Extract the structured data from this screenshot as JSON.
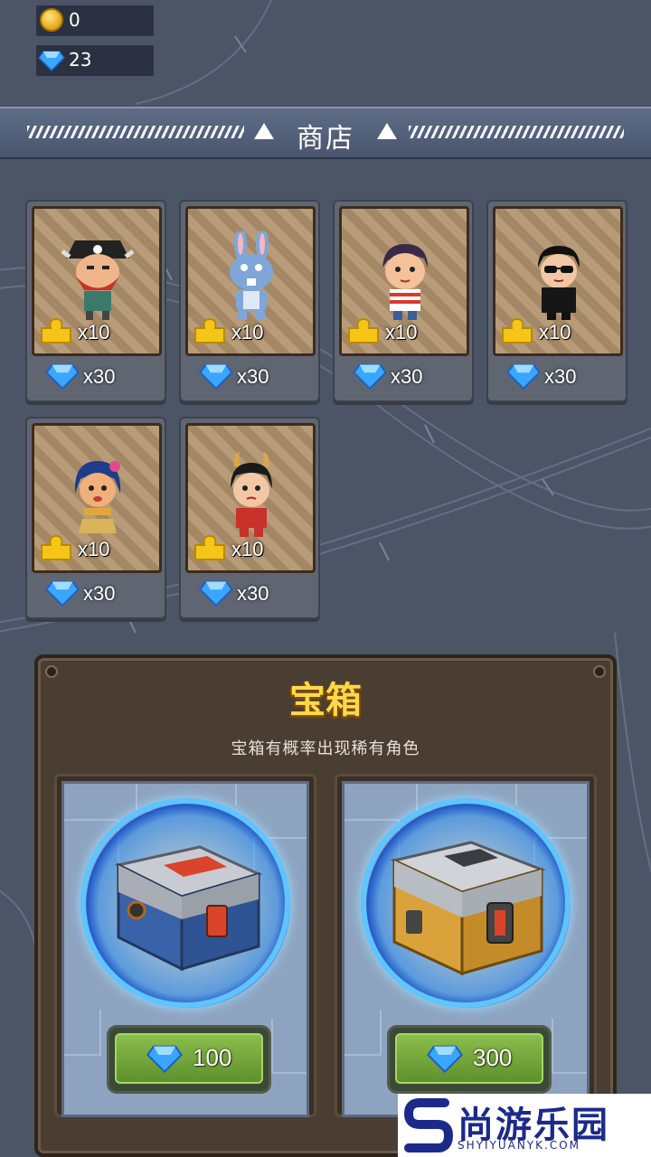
{
  "currency": {
    "coins": "0",
    "gems": "23",
    "coin_icon": "gold-coin-icon",
    "gem_icon": "blue-diamond-icon"
  },
  "shop": {
    "title": "商店"
  },
  "characters": [
    {
      "name_icon": "pirate-character",
      "fragments": "x10",
      "price": "x30"
    },
    {
      "name_icon": "rabbit-character",
      "fragments": "x10",
      "price": "x30"
    },
    {
      "name_icon": "striped-shirt-character",
      "fragments": "x10",
      "price": "x30"
    },
    {
      "name_icon": "sunglasses-character",
      "fragments": "x10",
      "price": "x30"
    },
    {
      "name_icon": "hula-girl-character",
      "fragments": "x10",
      "price": "x30"
    },
    {
      "name_icon": "devil-girl-character",
      "fragments": "x10",
      "price": "x30"
    }
  ],
  "chests": {
    "title": "宝箱",
    "subtitle": "宝箱有概率出现稀有角色",
    "items": [
      {
        "name_icon": "blue-chest",
        "price": "100"
      },
      {
        "name_icon": "gold-chest",
        "price": "300"
      }
    ]
  },
  "watermark": {
    "text": "尚游乐园",
    "url": "SHYIYUANYK.COM"
  },
  "colors": {
    "background": "#4b5566",
    "gem": "#3aa6ff",
    "buy_button": "#6fa03a",
    "chest_title": "#ffd84a"
  }
}
